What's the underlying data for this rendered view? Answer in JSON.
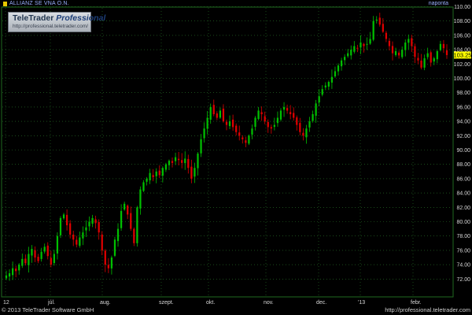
{
  "header": {
    "symbol": "ALLIANZ SE VNA O.N.",
    "period": "naponta"
  },
  "logo": {
    "brand": "TeleTrader",
    "product": "Professional",
    "url": "http://professional.teletrader.com/"
  },
  "footer": {
    "copyright": "© 2013 TeleTrader Software GmbH",
    "url": "http://professional.teletrader.com"
  },
  "last_price_label": "103.25",
  "colors": {
    "up": "#00c000",
    "down": "#e00000",
    "grid": "#2a7a2a",
    "axis_text": "#d8d8d8",
    "last_price_bg": "#ffff00"
  },
  "chart_data": {
    "type": "candlestick",
    "y_axis": {
      "ylim": [
        70,
        110
      ],
      "ticks": [
        "72.00",
        "74.00",
        "76.00",
        "78.00",
        "80.00",
        "82.00",
        "84.00",
        "86.00",
        "88.00",
        "90.00",
        "92.00",
        "94.00",
        "96.00",
        "98.00",
        "100.00",
        "102.00",
        "104.00",
        "106.00",
        "108.00",
        "110.00"
      ]
    },
    "x_axis": {
      "tick_labels": [
        "12",
        "júl.",
        "aug.",
        "szept.",
        "okt.",
        "nov.",
        "dec.",
        "'13",
        "febr."
      ]
    },
    "series": [
      {
        "close": 72.5
      },
      {
        "close": 72.8
      },
      {
        "close": 73.5
      },
      {
        "close": 73.1
      },
      {
        "close": 74.0
      },
      {
        "close": 74.8
      },
      {
        "close": 74.2
      },
      {
        "close": 75.5
      },
      {
        "close": 76.2
      },
      {
        "close": 75.0
      },
      {
        "close": 74.5
      },
      {
        "close": 75.8
      },
      {
        "close": 76.5
      },
      {
        "close": 75.2
      },
      {
        "close": 74.0
      },
      {
        "close": 75.5
      },
      {
        "close": 78.0
      },
      {
        "close": 80.5
      },
      {
        "close": 81.0
      },
      {
        "close": 79.5
      },
      {
        "close": 78.2
      },
      {
        "close": 77.5
      },
      {
        "close": 76.8
      },
      {
        "close": 77.8
      },
      {
        "close": 78.5
      },
      {
        "close": 79.2
      },
      {
        "close": 80.0
      },
      {
        "close": 80.5
      },
      {
        "close": 79.8
      },
      {
        "close": 78.5
      },
      {
        "close": 76.0
      },
      {
        "close": 74.0
      },
      {
        "close": 73.5
      },
      {
        "close": 75.0
      },
      {
        "close": 77.5
      },
      {
        "close": 79.0
      },
      {
        "close": 81.5
      },
      {
        "close": 82.5
      },
      {
        "close": 81.0
      },
      {
        "close": 79.0
      },
      {
        "close": 77.0
      },
      {
        "close": 82.0
      },
      {
        "close": 84.5
      },
      {
        "close": 85.5
      },
      {
        "close": 86.0
      },
      {
        "close": 86.8
      },
      {
        "close": 86.2
      },
      {
        "close": 87.0
      },
      {
        "close": 86.5
      },
      {
        "close": 87.5
      },
      {
        "close": 88.0
      },
      {
        "close": 88.5
      },
      {
        "close": 88.2
      },
      {
        "close": 89.0
      },
      {
        "close": 88.6
      },
      {
        "close": 88.2
      },
      {
        "close": 88.8
      },
      {
        "close": 87.5
      },
      {
        "close": 86.0
      },
      {
        "close": 87.5
      },
      {
        "close": 89.5
      },
      {
        "close": 91.5
      },
      {
        "close": 93.0
      },
      {
        "close": 94.5
      },
      {
        "close": 96.0
      },
      {
        "close": 95.0
      },
      {
        "close": 94.5
      },
      {
        "close": 95.5
      },
      {
        "close": 94.0
      },
      {
        "close": 93.5
      },
      {
        "close": 94.0
      },
      {
        "close": 93.2
      },
      {
        "close": 92.5
      },
      {
        "close": 92.0
      },
      {
        "close": 91.5
      },
      {
        "close": 91.0
      },
      {
        "close": 92.0
      },
      {
        "close": 93.0
      },
      {
        "close": 94.5
      },
      {
        "close": 95.5
      },
      {
        "close": 95.0
      },
      {
        "close": 94.0
      },
      {
        "close": 93.2
      },
      {
        "close": 93.0
      },
      {
        "close": 93.5
      },
      {
        "close": 94.5
      },
      {
        "close": 95.5
      },
      {
        "close": 96.0
      },
      {
        "close": 95.5
      },
      {
        "close": 95.0
      },
      {
        "close": 94.5
      },
      {
        "close": 93.5
      },
      {
        "close": 92.5
      },
      {
        "close": 92.0
      },
      {
        "close": 93.0
      },
      {
        "close": 94.0
      },
      {
        "close": 95.0
      },
      {
        "close": 96.5
      },
      {
        "close": 97.5
      },
      {
        "close": 98.5
      },
      {
        "close": 99.0
      },
      {
        "close": 99.5
      },
      {
        "close": 100.2
      },
      {
        "close": 101.0
      },
      {
        "close": 101.8
      },
      {
        "close": 102.5
      },
      {
        "close": 103.0
      },
      {
        "close": 103.5
      },
      {
        "close": 104.0
      },
      {
        "close": 104.5
      },
      {
        "close": 104.2
      },
      {
        "close": 105.0
      },
      {
        "close": 104.5
      },
      {
        "close": 104.8
      },
      {
        "close": 105.5
      },
      {
        "close": 108.0
      },
      {
        "close": 108.2
      },
      {
        "close": 107.5
      },
      {
        "close": 106.5
      },
      {
        "close": 105.5
      },
      {
        "close": 104.5
      },
      {
        "close": 103.5
      },
      {
        "close": 103.8
      },
      {
        "close": 103.2
      },
      {
        "close": 104.0
      },
      {
        "close": 105.0
      },
      {
        "close": 105.5
      },
      {
        "close": 104.5
      },
      {
        "close": 103.0
      },
      {
        "close": 102.5
      },
      {
        "close": 101.5
      },
      {
        "close": 102.8
      },
      {
        "close": 103.5
      },
      {
        "close": 102.2
      },
      {
        "close": 102.8
      },
      {
        "close": 103.8
      },
      {
        "close": 104.8
      },
      {
        "close": 104.2
      },
      {
        "close": 103.25
      }
    ]
  }
}
